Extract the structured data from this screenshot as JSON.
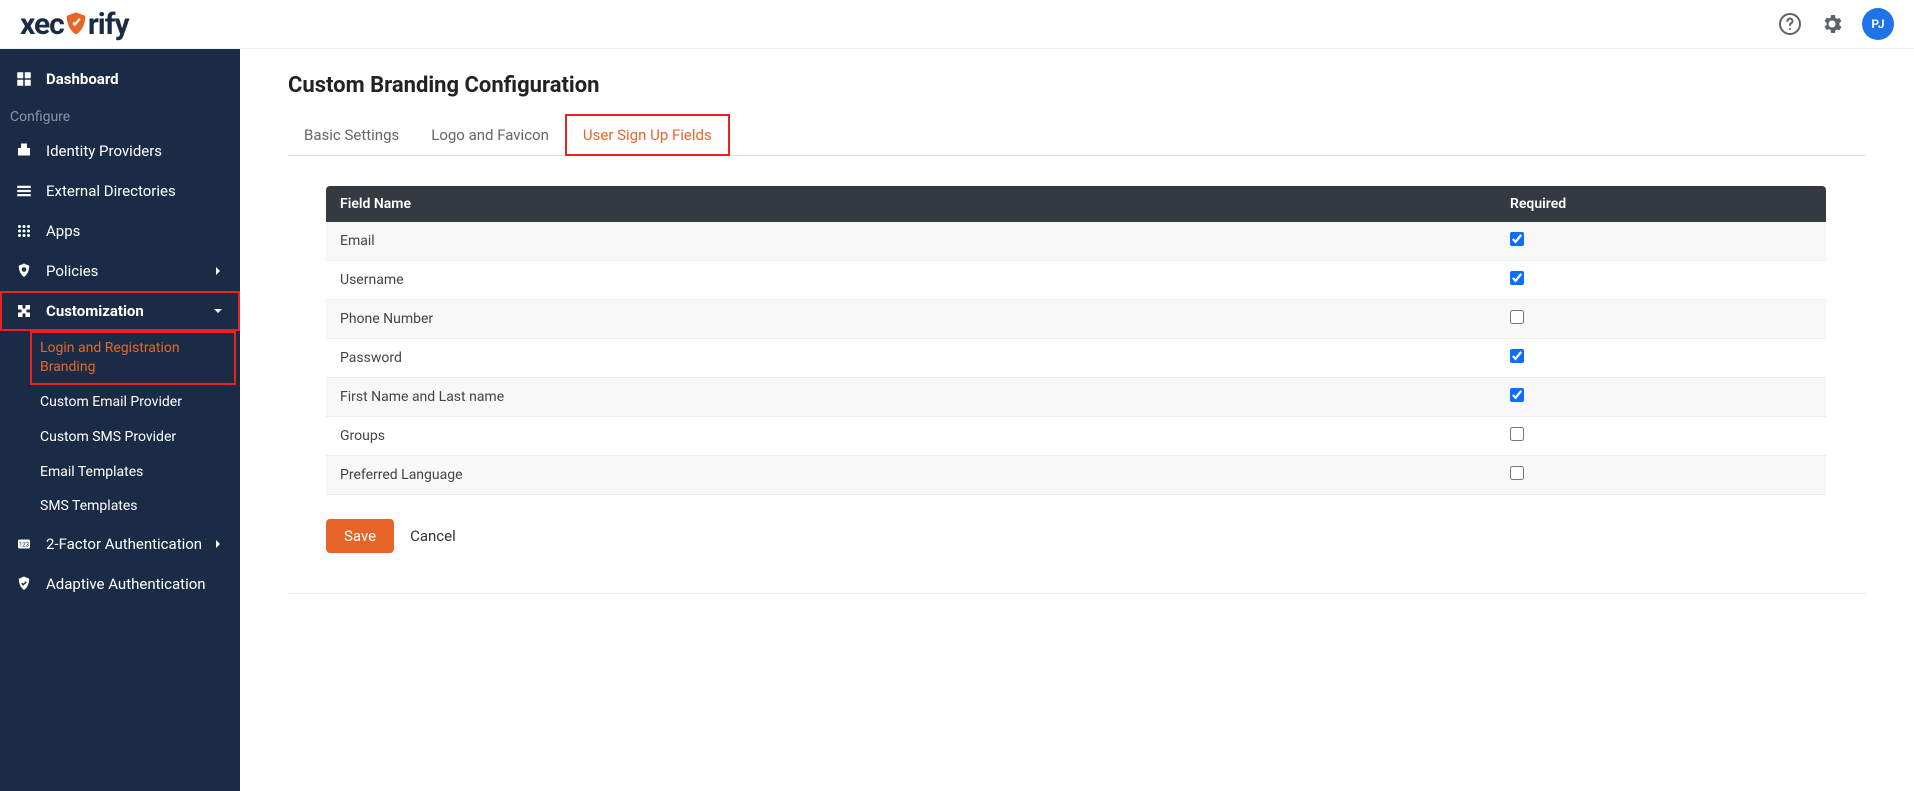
{
  "brand": {
    "name_pre": "xec",
    "name_post": "rify"
  },
  "header": {
    "avatar_initials": "PJ"
  },
  "sidebar": {
    "dashboard": "Dashboard",
    "section_configure": "Configure",
    "identity_providers": "Identity Providers",
    "external_directories": "External Directories",
    "apps": "Apps",
    "policies": "Policies",
    "customization": "Customization",
    "sub_login_branding": "Login and Registration Branding",
    "sub_email_provider": "Custom Email Provider",
    "sub_sms_provider": "Custom SMS Provider",
    "sub_email_templates": "Email Templates",
    "sub_sms_templates": "SMS Templates",
    "two_factor": "2-Factor Authentication",
    "adaptive": "Adaptive Authentication"
  },
  "page": {
    "title": "Custom Branding Configuration",
    "tabs": {
      "basic": "Basic Settings",
      "logo": "Logo and Favicon",
      "signup": "User Sign Up Fields"
    }
  },
  "table": {
    "col_field": "Field Name",
    "col_required": "Required",
    "rows": [
      {
        "name": "Email",
        "checked": true
      },
      {
        "name": "Username",
        "checked": true
      },
      {
        "name": "Phone Number",
        "checked": false
      },
      {
        "name": "Password",
        "checked": true
      },
      {
        "name": "First Name and Last name",
        "checked": true
      },
      {
        "name": "Groups",
        "checked": false
      },
      {
        "name": "Preferred Language",
        "checked": false
      }
    ]
  },
  "actions": {
    "save": "Save",
    "cancel": "Cancel"
  }
}
